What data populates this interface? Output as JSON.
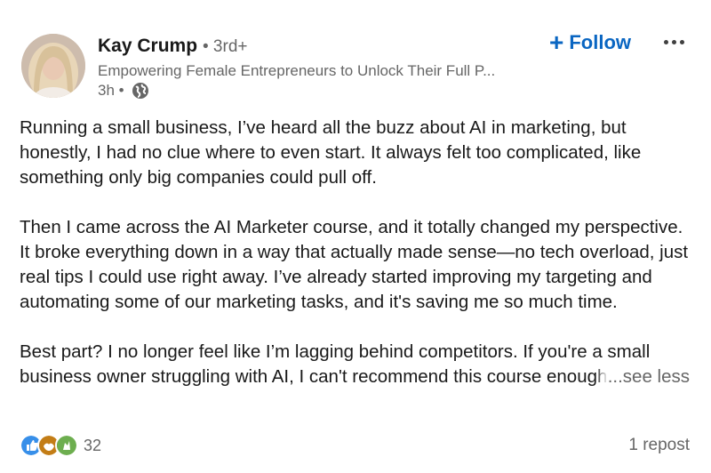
{
  "author": {
    "name": "Kay Crump",
    "degree": "• 3rd+",
    "headline": "Empowering Female Entrepreneurs to Unlock Their Full P...",
    "time": "3h •",
    "avatar_icon": "profile-photo"
  },
  "actions": {
    "follow_plus": "+",
    "follow_label": "Follow",
    "more_icon": "ellipsis-icon"
  },
  "post": {
    "paragraphs": [
      "Running a small business, I’ve heard all the buzz about AI in marketing, but honestly, I had no clue where to even start. It always felt too complicated, like something only big companies could pull off.",
      "Then I came across the AI Marketer course, and it totally changed my perspective. It broke everything down in a way that actually made sense—no tech overload, just real tips I could use right away. I’ve already started improving my targeting and automating some of our marketing tasks, and it's saving me so much time.",
      "Best part? I no longer feel like I’m lagging behind competitors. If you're a small"
    ],
    "last_line": "business owner struggling with AI, I can't recommend this course enough",
    "see_less": "...see less"
  },
  "social": {
    "reaction_count": "32",
    "reposts": "1 repost",
    "colors": {
      "like": "#378fe9",
      "celebrate": "#6dae4f",
      "support": "#c37d16"
    }
  },
  "colors": {
    "link_blue": "#0a66c2",
    "text": "#191919",
    "muted": "#666666"
  }
}
